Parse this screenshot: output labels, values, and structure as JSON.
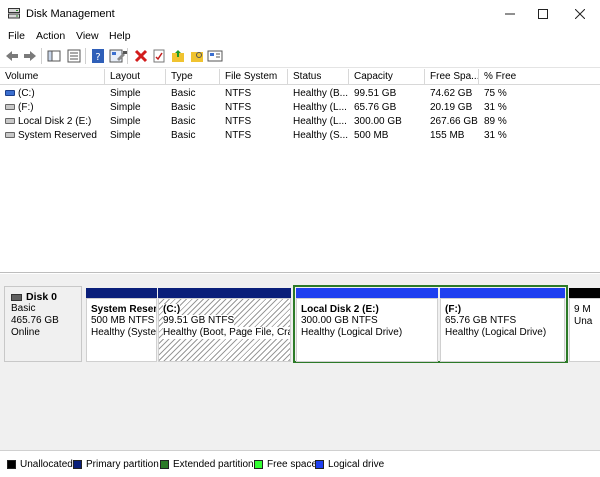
{
  "window": {
    "title": "Disk Management"
  },
  "menu": {
    "items": [
      "File",
      "Action",
      "View",
      "Help"
    ]
  },
  "volume_list": {
    "columns": [
      "Volume",
      "Layout",
      "Type",
      "File System",
      "Status",
      "Capacity",
      "Free Spa...",
      "% Free"
    ],
    "rows": [
      {
        "volume": "(C:)",
        "layout": "Simple",
        "type": "Basic",
        "fs": "NTFS",
        "status": "Healthy (B...",
        "capacity": "99.51 GB",
        "free": "74.62 GB",
        "pct": "75 %",
        "icon": "drive-icon"
      },
      {
        "volume": "(F:)",
        "layout": "Simple",
        "type": "Basic",
        "fs": "NTFS",
        "status": "Healthy (L...",
        "capacity": "65.76 GB",
        "free": "20.19 GB",
        "pct": "31 %",
        "icon": "drive-icon"
      },
      {
        "volume": "Local Disk 2 (E:)",
        "layout": "Simple",
        "type": "Basic",
        "fs": "NTFS",
        "status": "Healthy (L...",
        "capacity": "300.00 GB",
        "free": "267.66 GB",
        "pct": "89 %",
        "icon": "drive-icon"
      },
      {
        "volume": "System Reserved",
        "layout": "Simple",
        "type": "Basic",
        "fs": "NTFS",
        "status": "Healthy (S...",
        "capacity": "500 MB",
        "free": "155 MB",
        "pct": "31 %",
        "icon": "drive-icon"
      }
    ]
  },
  "disk": {
    "name": "Disk 0",
    "type": "Basic",
    "size": "465.76 GB",
    "state": "Online",
    "partitions": [
      {
        "title": "System Reser",
        "size": "500 MB NTFS",
        "status": "Healthy (Syste",
        "bar_color": "#0a1f7a"
      },
      {
        "title": "(C:)",
        "size": "99.51 GB NTFS",
        "status": "Healthy (Boot, Page File, Cras",
        "bar_color": "#0a1f7a"
      },
      {
        "title": "Local Disk 2  (E:)",
        "size": "300.00 GB NTFS",
        "status": "Healthy (Logical Drive)",
        "bar_color": "#1e3ff0"
      },
      {
        "title": "(F:)",
        "size": "65.76 GB NTFS",
        "status": "Healthy (Logical Drive)",
        "bar_color": "#1e3ff0"
      },
      {
        "title": "",
        "size": "9 M",
        "status": "Una",
        "bar_color": "#000000"
      }
    ]
  },
  "legend": [
    {
      "label": "Unallocated",
      "color": "#000000"
    },
    {
      "label": "Primary partition",
      "color": "#0a1f7a"
    },
    {
      "label": "Extended partition",
      "color": "#2c7a28"
    },
    {
      "label": "Free space",
      "color": "#33ff33"
    },
    {
      "label": "Logical drive",
      "color": "#1e3ff0"
    }
  ],
  "colors": {
    "extended_border": "#2c7a28"
  }
}
